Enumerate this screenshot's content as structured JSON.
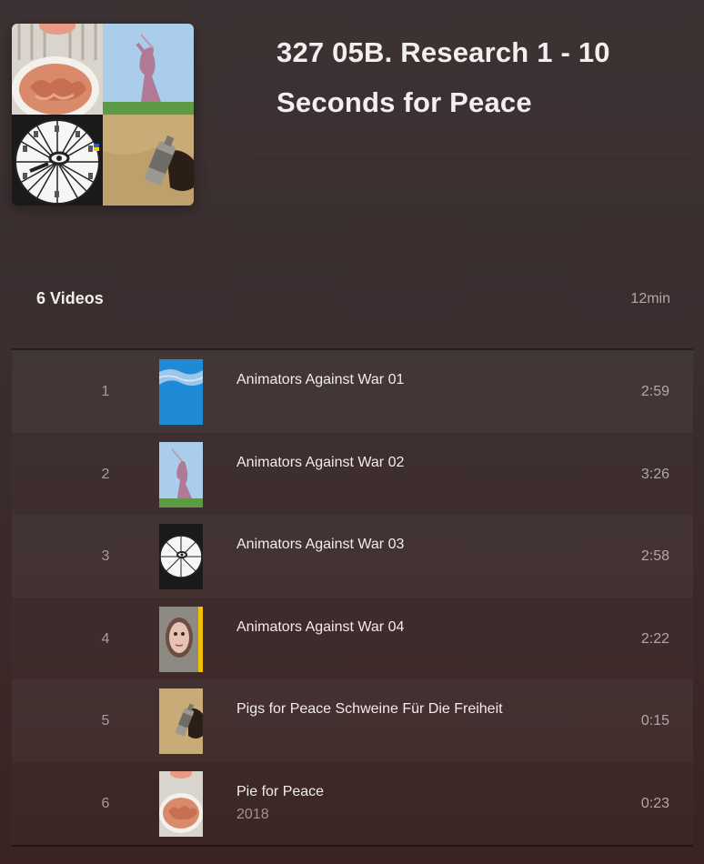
{
  "playlist": {
    "title_line1": "327 05B. Research 1 - 10",
    "title_line2": "Seconds for Peace",
    "count_label": "6 Videos",
    "total_duration": "12min"
  },
  "colors": {
    "background": "#3a2e2f",
    "text_primary": "#f2eeee",
    "text_secondary": "#b3a7a7"
  },
  "videos": [
    {
      "index": "1",
      "title": "Animators Against War 01",
      "subtitle": "",
      "duration": "2:59",
      "thumbnail": "blue-sky-thumbnail"
    },
    {
      "index": "2",
      "title": "Animators Against War 02",
      "subtitle": "",
      "duration": "3:26",
      "thumbnail": "statue-thumbnail"
    },
    {
      "index": "3",
      "title": "Animators Against War 03",
      "subtitle": "",
      "duration": "2:58",
      "thumbnail": "wheel-thumbnail"
    },
    {
      "index": "4",
      "title": "Animators Against War 04",
      "subtitle": "",
      "duration": "2:22",
      "thumbnail": "face-thumbnail"
    },
    {
      "index": "5",
      "title": "Pigs for Peace Schweine Für Die Freiheit",
      "subtitle": "",
      "duration": "0:15",
      "thumbnail": "spray-can-thumbnail"
    },
    {
      "index": "6",
      "title": "Pie for Peace",
      "subtitle": "2018",
      "duration": "0:23",
      "thumbnail": "pie-thumbnail"
    }
  ]
}
